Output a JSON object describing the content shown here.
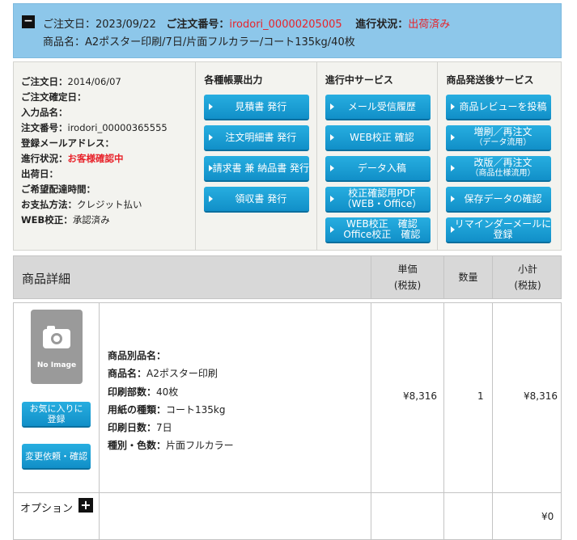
{
  "header": {
    "toggle_symbol": "−",
    "order_date_label": "ご注文日：",
    "order_date": "2023/09/22",
    "order_no_label": "ご注文番号：",
    "order_no": "irodori_00000205005",
    "status_label": "進行状況：",
    "status": "出荷済み",
    "product_label": "商品名：",
    "product": "A2ポスター印刷/7日/片面フルカラー/コート135kg/40枚"
  },
  "info": [
    {
      "label": "ご注文日：",
      "value": "2014/06/07"
    },
    {
      "label": "ご注文確定日：",
      "value": ""
    },
    {
      "label": "入力品名：",
      "value": ""
    },
    {
      "label": "注文番号：",
      "value": "irodori_00000365555"
    },
    {
      "label": "登録メールアドレス：",
      "value": ""
    },
    {
      "label": "進行状況：",
      "value": "お客様確認中"
    },
    {
      "label": "出荷日：",
      "value": ""
    },
    {
      "label": "ご希望配達時間：",
      "value": ""
    },
    {
      "label": "お支払方法：",
      "value": "クレジット払い"
    },
    {
      "label": "WEB校正：",
      "value": "承認済み"
    }
  ],
  "docs": {
    "title": "各種帳票出力",
    "buttons": [
      "見積書 発行",
      "注文明細書 発行",
      "請求書 兼 納品書 発行",
      "領収書 発行"
    ]
  },
  "services": {
    "title": "進行中サービス",
    "buttons": [
      "メール受信履歴",
      "WEB校正 確認",
      "データ入稿",
      "校正確認用PDF\n（WEB・Office）",
      "WEB校正　確認\nOffice校正　確認"
    ]
  },
  "after": {
    "title": "商品発送後サービス",
    "buttons": [
      {
        "main": "商品レビューを投稿",
        "sub": ""
      },
      {
        "main": "増刷／再注文",
        "sub": "（データ流用）"
      },
      {
        "main": "改版／再注文",
        "sub": "（商品仕様流用）"
      },
      {
        "main": "保存データの確認",
        "sub": ""
      },
      {
        "main": "リマインダーメールに\n登録",
        "sub": ""
      }
    ]
  },
  "table": {
    "title": "商品詳細",
    "col_price": "単価\n(税抜)",
    "col_qty": "数量",
    "col_subtotal": "小計\n(税抜)",
    "no_image": "No Image",
    "fav_button": "お気に入りに\n登録",
    "change_button": "変更依頼・確認",
    "details": [
      {
        "label": "商品別品名：",
        "value": ""
      },
      {
        "label": "商品名：",
        "value": "A2ポスター印刷"
      },
      {
        "label": "印刷部数：",
        "value": "40枚"
      },
      {
        "label": "用紙の種類：",
        "value": "コート135kg"
      },
      {
        "label": "印刷日数：",
        "value": "7日"
      },
      {
        "label": "種別・色数：",
        "value": "片面フルカラー"
      }
    ],
    "unit_price": "¥8,316",
    "quantity": "1",
    "subtotal": "¥8,316",
    "option_label": "オプション",
    "option_total": "¥0"
  }
}
